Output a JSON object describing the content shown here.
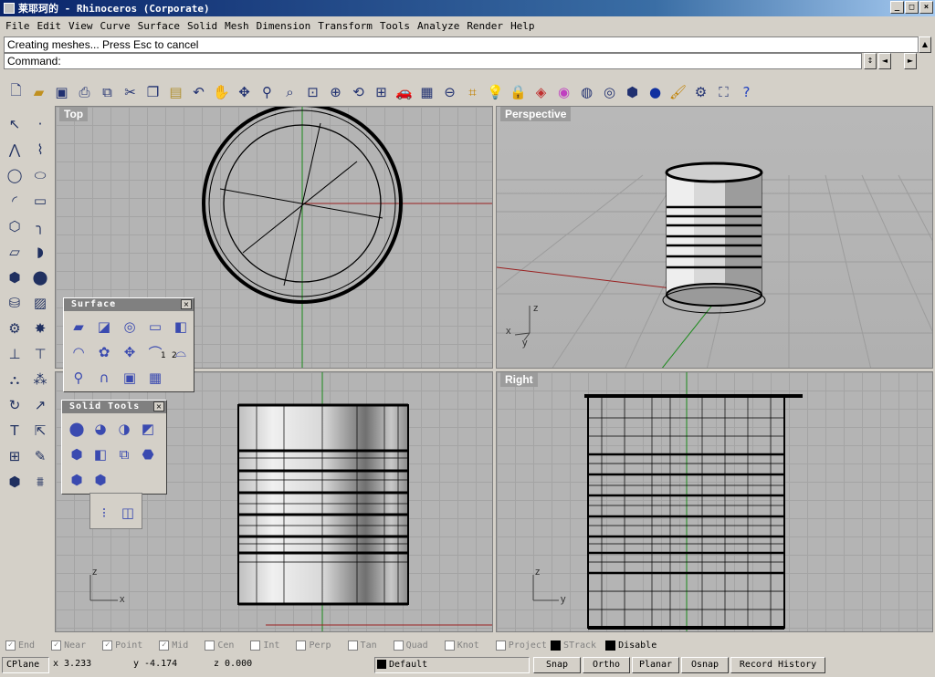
{
  "window": {
    "title": "莱耶珂的 - Rhinoceros (Corporate)",
    "buttons": [
      "_",
      "□",
      "×"
    ]
  },
  "menu": [
    "File",
    "Edit",
    "View",
    "Curve",
    "Surface",
    "Solid",
    "Mesh",
    "Dimension",
    "Transform",
    "Tools",
    "Analyze",
    "Render",
    "Help"
  ],
  "command": {
    "history": "Creating meshes... Press Esc to cancel",
    "prompt": "Command:"
  },
  "toolbar_icons": [
    "new-icon",
    "open-icon",
    "save-icon",
    "print-icon",
    "import-icon",
    "cut-icon",
    "copy-icon",
    "paste-icon",
    "undo-icon",
    "pan-icon",
    "rotate-view-icon",
    "zoom-icon",
    "zoom-window-icon",
    "zoom-extents-icon",
    "zoom-selected-icon",
    "undo-view-icon",
    "four-viewports-icon",
    "car-icon",
    "grid-icon",
    "cplane-icon",
    "point-snap-icon",
    "light-icon",
    "lock-icon",
    "layer-icon",
    "color-wheel-icon",
    "wireframe-icon",
    "shaded-icon",
    "render-icon",
    "sphere-icon",
    "brush-icon",
    "gear-icon",
    "cplane-options-icon",
    "help-icon"
  ],
  "viewports": {
    "top": "Top",
    "perspective": "Perspective",
    "front": "",
    "right": "Right"
  },
  "axes": {
    "z": "z",
    "x": "x",
    "y": "y"
  },
  "panels": {
    "surface": {
      "title": "Surface",
      "close": "×",
      "corner_labels": [
        "1",
        "2"
      ]
    },
    "solid_tools": {
      "title": "Solid Tools",
      "close": "×"
    }
  },
  "osnaps": [
    {
      "label": "End",
      "checked": true
    },
    {
      "label": "Near",
      "checked": true
    },
    {
      "label": "Point",
      "checked": true
    },
    {
      "label": "Mid",
      "checked": true
    },
    {
      "label": "Cen",
      "checked": false
    },
    {
      "label": "Int",
      "checked": false
    },
    {
      "label": "Perp",
      "checked": false
    },
    {
      "label": "Tan",
      "checked": false
    },
    {
      "label": "Quad",
      "checked": false
    },
    {
      "label": "Knot",
      "checked": false
    },
    {
      "label": "Project",
      "checked": false
    },
    {
      "label": "STrack",
      "checked": false
    },
    {
      "label": "Disable",
      "checked": false
    }
  ],
  "status": {
    "cplane": "CPlane",
    "x": "x 3.233",
    "y": "y -4.174",
    "z": "z 0.000",
    "layer": "Default",
    "snap": "Snap",
    "ortho": "Ortho",
    "planar": "Planar",
    "osnap": "Osnap",
    "record_history": "Record History"
  },
  "colors": {
    "title_start": "#0a246a",
    "viewport_bg": "#b4b4b4",
    "x_axis": "#9a2020",
    "y_axis": "#1a8a1a"
  }
}
